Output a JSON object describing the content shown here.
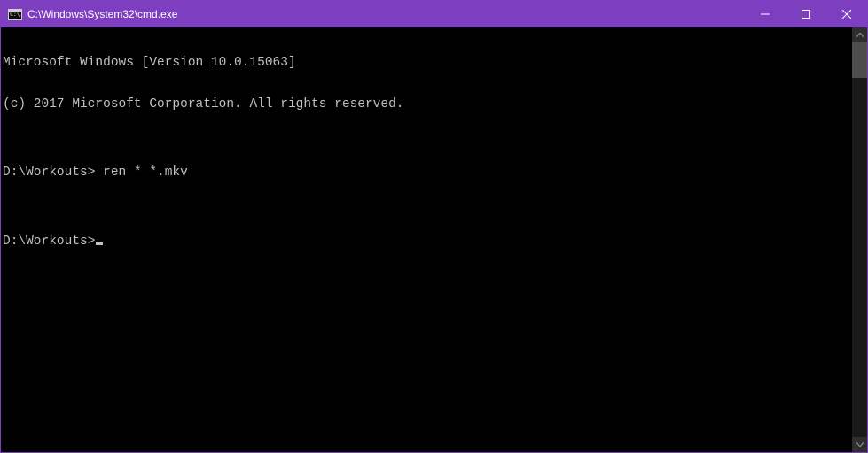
{
  "titlebar": {
    "title": "C:\\Windows\\System32\\cmd.exe",
    "icon_label": "C:\\."
  },
  "terminal": {
    "lines": [
      "Microsoft Windows [Version 10.0.15063]",
      "(c) 2017 Microsoft Corporation. All rights reserved.",
      "",
      "D:\\Workouts> ren * *.mkv",
      "",
      "D:\\Workouts>"
    ]
  }
}
